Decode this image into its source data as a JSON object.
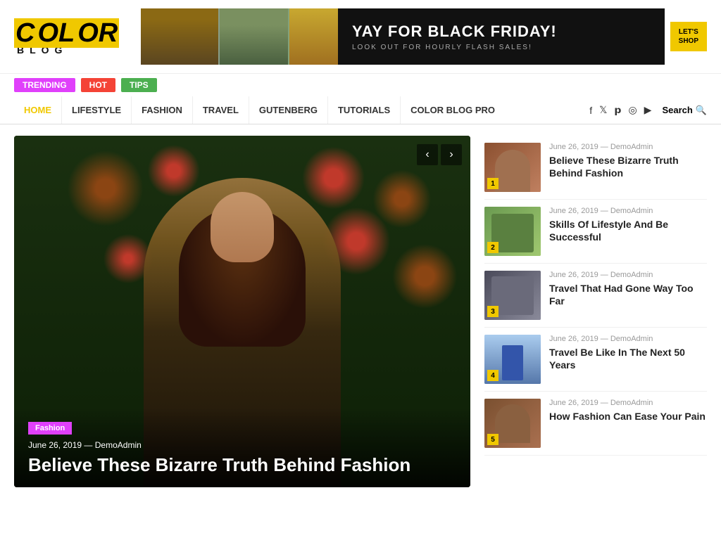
{
  "logo": {
    "color_text": "COLOR",
    "blog_text": "BLOG"
  },
  "banner": {
    "title": "YAY FOR BLACK FRIDAY!",
    "subtitle": "LOOK OUT FOR HOURLY FLASH SALES!",
    "button": "LET'S\nSHOP"
  },
  "tags": [
    {
      "label": "TRENDING",
      "class": "tag-trending"
    },
    {
      "label": "HOT",
      "class": "tag-hot"
    },
    {
      "label": "TIPS",
      "class": "tag-tips"
    }
  ],
  "nav": {
    "items": [
      {
        "label": "HOME"
      },
      {
        "label": "LIFESTYLE"
      },
      {
        "label": "FASHION"
      },
      {
        "label": "TRAVEL"
      },
      {
        "label": "GUTENBERG"
      },
      {
        "label": "TUTORIALS"
      },
      {
        "label": "COLOR BLOG PRO"
      }
    ],
    "search_label": "Search"
  },
  "hero": {
    "category": "Fashion",
    "date": "June 26, 2019",
    "author": "DemoAdmin",
    "title": "Believe These Bizarre Truth Behind Fashion"
  },
  "sidebar": {
    "items": [
      {
        "number": "1",
        "date": "June 26, 2019",
        "author": "DemoAdmin",
        "title": "Believe These Bizarre Truth Behind Fashion",
        "thumb_class": "thumb-1"
      },
      {
        "number": "2",
        "date": "June 26, 2019",
        "author": "DemoAdmin",
        "title": "Skills Of Lifestyle And Be Successful",
        "thumb_class": "thumb-2"
      },
      {
        "number": "3",
        "date": "June 26, 2019",
        "author": "DemoAdmin",
        "title": "Travel That Had Gone Way Too Far",
        "thumb_class": "thumb-3"
      },
      {
        "number": "4",
        "date": "June 26, 2019",
        "author": "DemoAdmin",
        "title": "Travel Be Like In The Next 50 Years",
        "thumb_class": "thumb-4"
      },
      {
        "number": "5",
        "date": "June 26, 2019",
        "author": "DemoAdmin",
        "title": "How Fashion Can Ease Your Pain",
        "thumb_class": "thumb-5"
      }
    ]
  }
}
